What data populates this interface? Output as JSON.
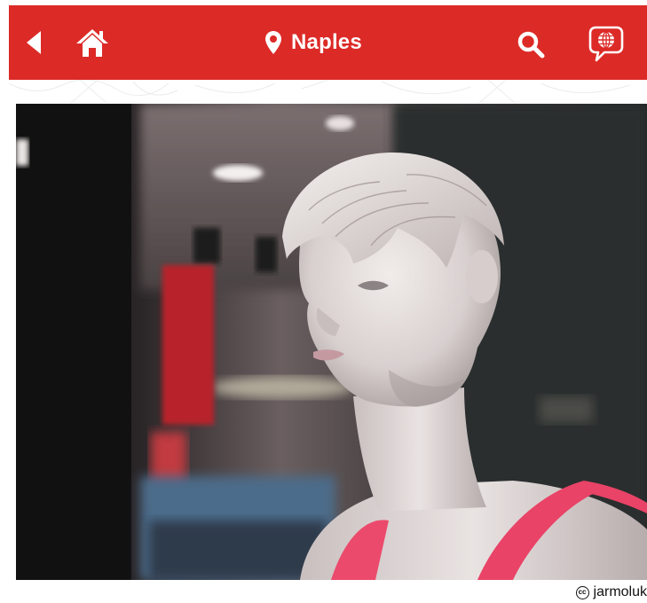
{
  "header": {
    "location_title": "Naples",
    "back_icon": "back-arrow-icon",
    "home_icon": "home-icon",
    "location_icon": "map-pin-icon",
    "search_icon": "search-icon",
    "language_icon": "globe-speech-bubble-icon"
  },
  "photo": {
    "subject": "mannequin",
    "credit_icon": "creative-commons-icon",
    "credit_author": "jarmoluk"
  },
  "colors": {
    "header_bg": "#dc2a27",
    "header_fg": "#ffffff"
  }
}
